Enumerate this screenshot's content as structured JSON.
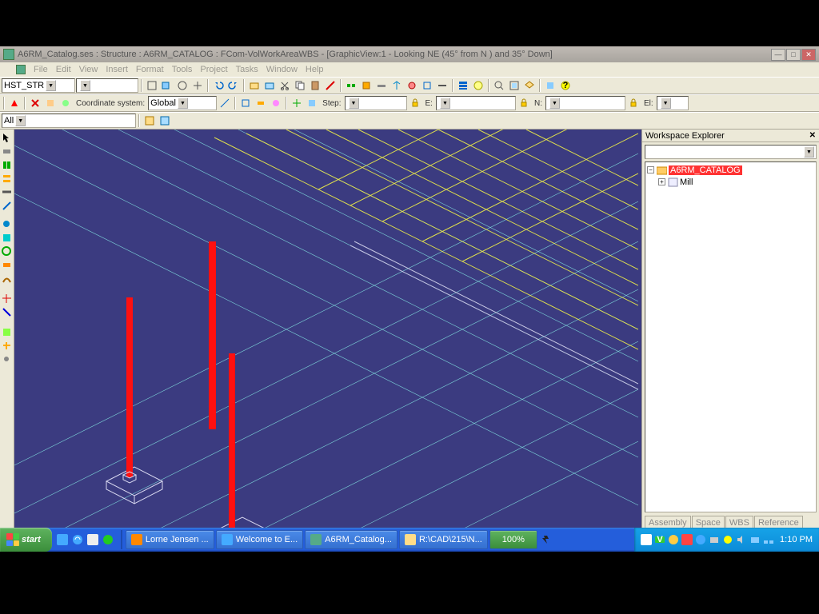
{
  "window": {
    "title": "A6RM_Catalog.ses : Structure : A6RM_CATALOG : FCom-VolWorkAreaWBS - [GraphicView:1 - Looking NE (45° from N ) and 35° Down]"
  },
  "menu": {
    "file": "File",
    "edit": "Edit",
    "view": "View",
    "insert": "Insert",
    "format": "Format",
    "tools": "Tools",
    "project": "Project",
    "tasks": "Tasks",
    "window": "Window",
    "help": "Help"
  },
  "toolbar": {
    "combo1": "HST_STR",
    "combo2": "",
    "coord_label": "Coordinate system:",
    "coord_value": "Global",
    "step_label": "Step:",
    "step_value": "",
    "e_label": "E:",
    "n_label": "N:",
    "el_label": "El:",
    "all": "All"
  },
  "explorer": {
    "title": "Workspace Explorer",
    "root": "A6RM_CATALOG",
    "child": "Mill",
    "tabs": [
      "Assembly",
      "Space",
      "WBS",
      "Reference"
    ]
  },
  "taskbar": {
    "start": "start",
    "tasks": [
      "Lorne Jensen ...",
      "Welcome to E...",
      "A6RM_Catalog...",
      "R:\\CAD\\215\\N..."
    ],
    "battery": "100%",
    "time": "1:10 PM"
  }
}
